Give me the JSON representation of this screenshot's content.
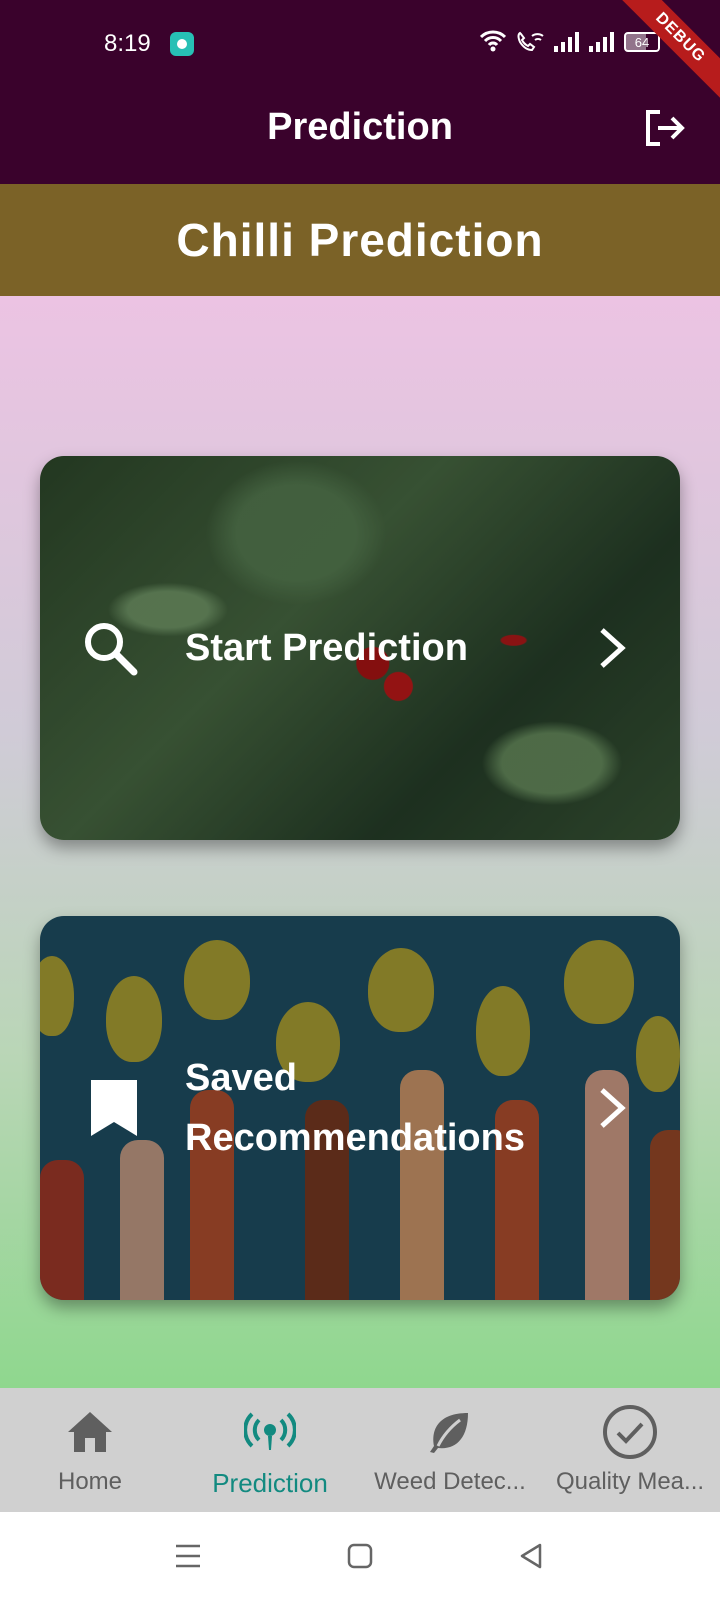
{
  "status_bar": {
    "time": "8:19",
    "battery": "64",
    "debug_banner": "DEBUG"
  },
  "app_bar": {
    "title": "Prediction",
    "logout_icon": "logout-icon"
  },
  "section": {
    "title": "Chilli Prediction"
  },
  "cards": [
    {
      "label": "Start Prediction",
      "icon": "search-icon"
    },
    {
      "label_line1": "Saved",
      "label_line2": "Recommendations",
      "icon": "bookmark-icon"
    }
  ],
  "bottom_nav": {
    "items": [
      {
        "label": "Home",
        "icon": "home-icon"
      },
      {
        "label": "Prediction",
        "icon": "sensors-icon",
        "active": true
      },
      {
        "label": "Weed Detec...",
        "icon": "leaf-icon"
      },
      {
        "label": "Quality Mea...",
        "icon": "check-circle-icon"
      }
    ],
    "active_color": "#128a80"
  },
  "colors": {
    "app_bar": "#3a022c",
    "section_bar": "#7b6227"
  }
}
